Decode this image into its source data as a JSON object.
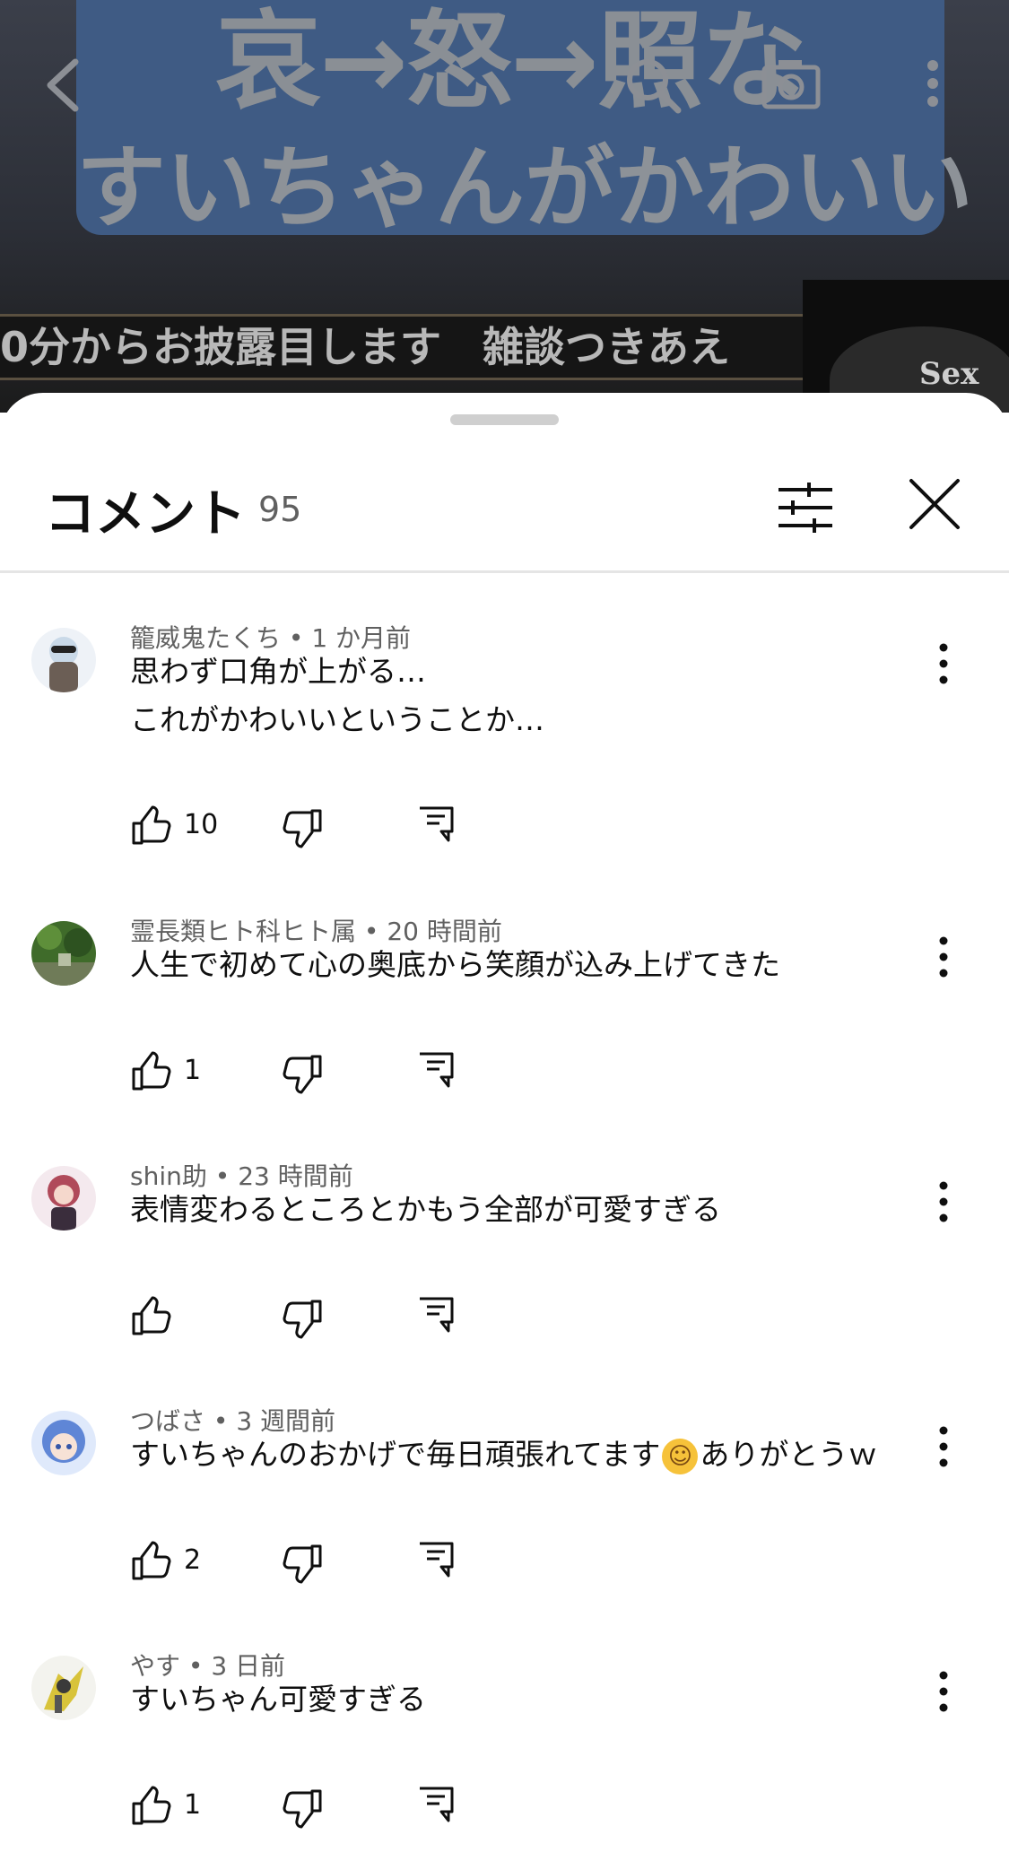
{
  "video": {
    "thumb_line1": "哀→怒→照な",
    "thumb_line2": "すいちゃんがかわいい",
    "ticker": "0分からお披露目します　雑談つきあえ",
    "side_text": "Sex"
  },
  "sheet": {
    "title": "コメント",
    "count": "95"
  },
  "comments": [
    {
      "author": "籠威鬼たくち",
      "time": "1 か月前",
      "lines": [
        "思わず口角が上がる…",
        "これがかわいいということか…"
      ],
      "likes": "10",
      "avatar_color": "#c9d9e8"
    },
    {
      "author": "霊長類ヒト科ヒト属",
      "time": "20 時間前",
      "lines": [
        "人生で初めて心の奥底から笑顔が込み上げてきた"
      ],
      "likes": "1",
      "avatar_color": "#3f6b2a"
    },
    {
      "author": "shin助",
      "time": "23 時間前",
      "lines": [
        "表情変わるところとかもう全部が可愛すぎる"
      ],
      "likes": "",
      "avatar_color": "#e8b7c1"
    },
    {
      "author": "つばさ",
      "time": "3 週間前",
      "lines_before_emoji": "すいちゃんのおかげで毎日頑張れてます",
      "emoji": "☺",
      "lines_after_emoji": "ありがとうｗ",
      "likes": "2",
      "avatar_color": "#5f86d6"
    },
    {
      "author": "やす",
      "time": "3 日前",
      "lines": [
        "すいちゃん可愛すぎる"
      ],
      "likes": "1",
      "avatar_color": "#d8d8c8"
    }
  ],
  "separator": "•"
}
